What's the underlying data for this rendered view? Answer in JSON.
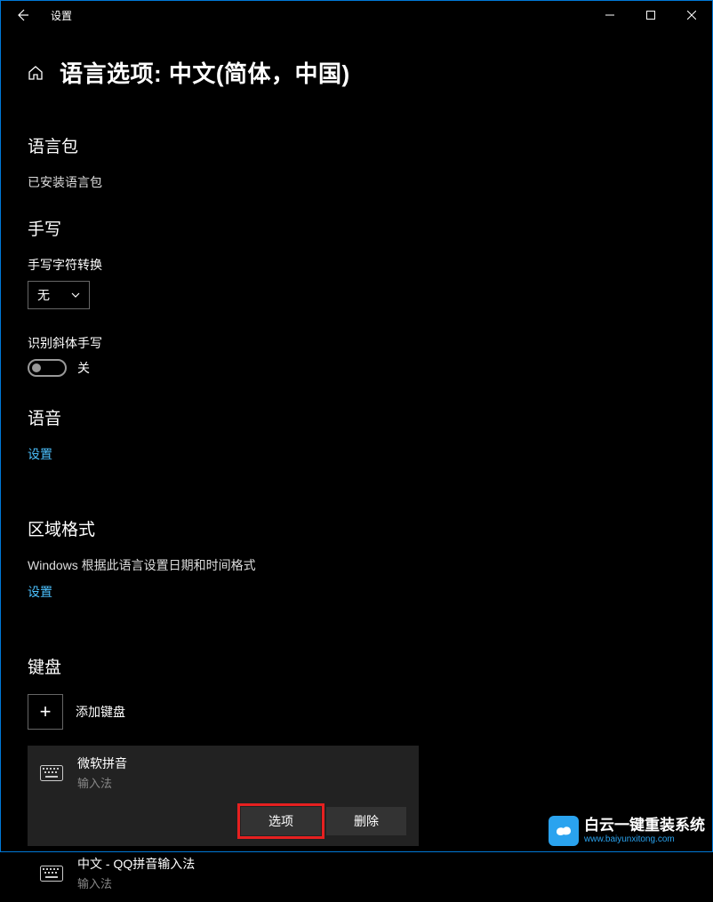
{
  "titlebar": {
    "title": "设置"
  },
  "header": {
    "page_title": "语言选项: 中文(简体，中国)"
  },
  "languagePack": {
    "heading": "语言包",
    "status": "已安装语言包"
  },
  "handwriting": {
    "heading": "手写",
    "conversion_label": "手写字符转换",
    "conversion_value": "无",
    "cursive_label": "识别斜体手写",
    "cursive_state": "关"
  },
  "speech": {
    "heading": "语音",
    "link": "设置"
  },
  "region": {
    "heading": "区域格式",
    "desc": "Windows 根据此语言设置日期和时间格式",
    "link": "设置"
  },
  "keyboards": {
    "heading": "键盘",
    "add_label": "添加键盘",
    "items": [
      {
        "name": "微软拼音",
        "sub": "输入法",
        "selected": true
      },
      {
        "name": "中文 - QQ拼音输入法",
        "sub": "输入法",
        "selected": false
      }
    ],
    "options_label": "选项",
    "remove_label": "删除"
  },
  "watermark": {
    "main": "白云一键重装系统",
    "sub": "www.baiyunxitong.com"
  }
}
